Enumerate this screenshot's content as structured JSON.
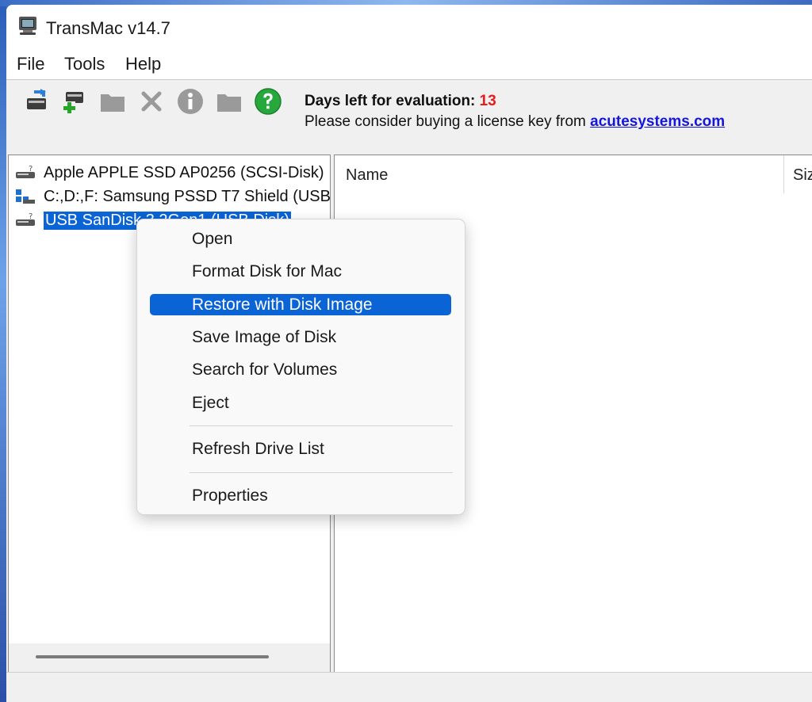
{
  "window": {
    "title": "TransMac v14.7"
  },
  "menubar": {
    "items": [
      "File",
      "Tools",
      "Help"
    ]
  },
  "toolbar": {
    "buttons": [
      {
        "icon": "open-disk-icon",
        "enabled": true
      },
      {
        "icon": "add-disk-icon",
        "enabled": true
      },
      {
        "icon": "new-folder-icon",
        "enabled": false
      },
      {
        "icon": "delete-icon",
        "enabled": false
      },
      {
        "icon": "info-icon",
        "enabled": false
      },
      {
        "icon": "folder-icon",
        "enabled": false
      },
      {
        "icon": "help-icon",
        "enabled": true
      }
    ],
    "eval_label": "Days left for evaluation: ",
    "eval_days": "13",
    "eval_message": "Please consider buying a license key from ",
    "eval_link": "acutesystems.com"
  },
  "tree": {
    "items": [
      {
        "label": "Apple APPLE SSD AP0256 (SCSI-Disk)",
        "icon": "disk-icon",
        "selected": false
      },
      {
        "label": "C:,D:,F: Samsung PSSD T7 Shield (USB",
        "icon": "windows-drive-icon",
        "selected": false
      },
      {
        "label": "USB SanDisk 3.2Gen1 (USB Disk)",
        "icon": "disk-icon",
        "selected": true
      }
    ]
  },
  "list": {
    "columns": [
      "Name",
      "Siz"
    ]
  },
  "context_menu": {
    "items": [
      {
        "label": "Open",
        "highlighted": false
      },
      {
        "label": "Format Disk for Mac",
        "highlighted": false
      },
      {
        "label": "Restore with Disk Image",
        "highlighted": true
      },
      {
        "label": "Save Image of Disk",
        "highlighted": false
      },
      {
        "label": "Search for Volumes",
        "highlighted": false
      },
      {
        "label": "Eject",
        "highlighted": false
      },
      {
        "label": "Refresh Drive List",
        "highlighted": false
      },
      {
        "label": "Properties",
        "highlighted": false
      }
    ]
  },
  "colors": {
    "selection": "#0a64d6",
    "eval_days": "#e81b1b",
    "link": "#1515e0"
  }
}
